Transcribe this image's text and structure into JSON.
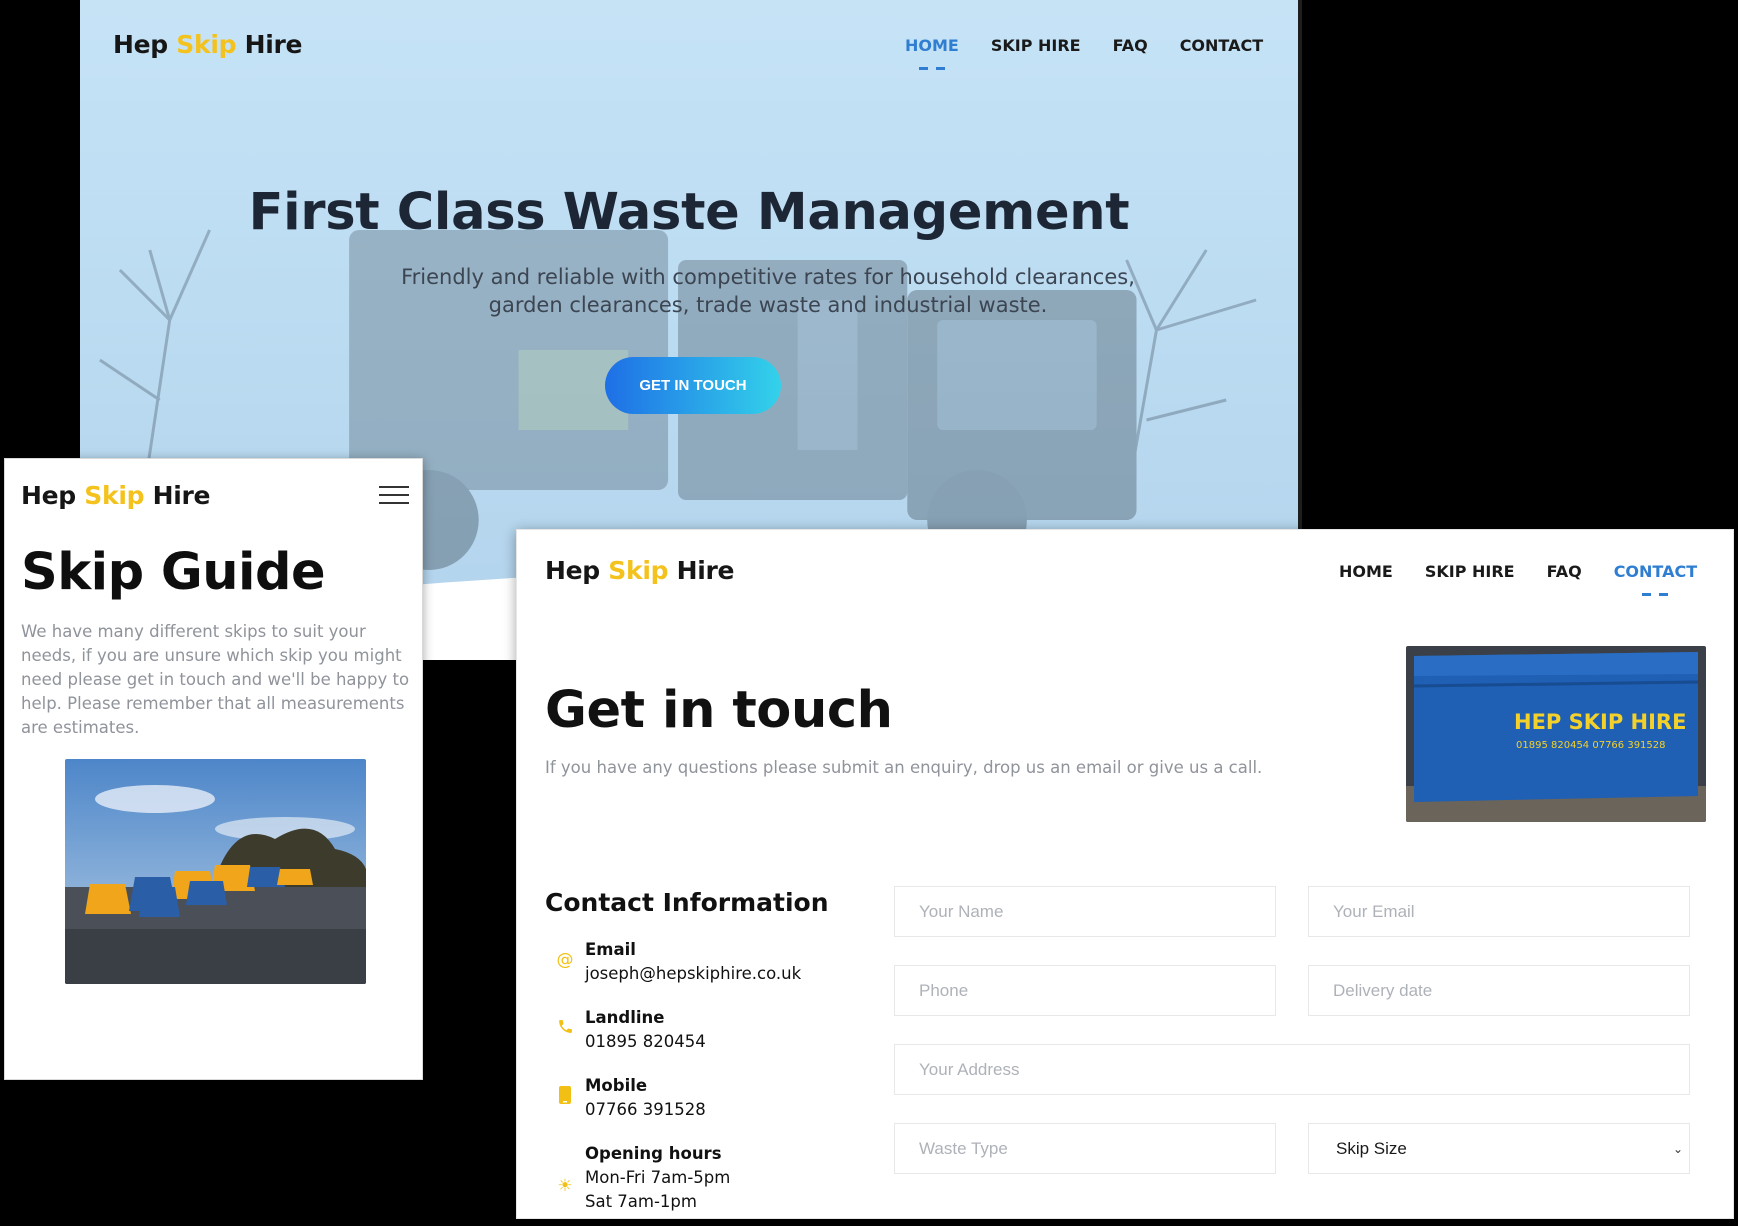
{
  "brand": {
    "part1": "Hep",
    "part2": "Skip",
    "part3": "Hire"
  },
  "hero": {
    "nav": [
      "HOME",
      "SKIP HIRE",
      "FAQ",
      "CONTACT"
    ],
    "active_nav": "HOME",
    "title": "First Class Waste Management",
    "subtitle": "Friendly and reliable with competitive rates for household clearances, garden clearances, trade waste and industrial waste.",
    "cta": "GET IN TOUCH"
  },
  "skip_guide": {
    "title": "Skip Guide",
    "text": "We have many different skips to suit your needs, if you are unsure which skip you might need please get in touch and we'll be happy to help. Please remember that all measurements are estimates."
  },
  "contact_page": {
    "nav": [
      "HOME",
      "SKIP HIRE",
      "FAQ",
      "CONTACT"
    ],
    "active_nav": "CONTACT",
    "title": "Get in touch",
    "subtitle": "If you have any questions please submit an enquiry, drop us an email or give us a call.",
    "info_title": "Contact Information",
    "items": [
      {
        "label": "Email",
        "lines": [
          "joseph@hepskiphire.co.uk"
        ],
        "icon": "at-icon"
      },
      {
        "label": "Landline",
        "lines": [
          "01895 820454"
        ],
        "icon": "phone-icon"
      },
      {
        "label": "Mobile",
        "lines": [
          "07766 391528"
        ],
        "icon": "mobile-icon"
      },
      {
        "label": "Opening hours",
        "lines": [
          "Mon-Fri 7am-5pm",
          "Sat 7am-1pm"
        ],
        "icon": "sun-icon"
      }
    ],
    "form": {
      "name_placeholder": "Your Name",
      "email_placeholder": "Your Email",
      "phone_placeholder": "Phone",
      "delivery_placeholder": "Delivery date",
      "address_placeholder": "Your Address",
      "waste_placeholder": "Waste Type",
      "skip_size_selected": "Skip Size"
    },
    "photo_skip_text": "HEP SKIP HIRE",
    "photo_skip_phones": "01895 820454  07766 391528"
  },
  "colors": {
    "accent_yellow": "#f4c21d",
    "accent_blue": "#2f7ed1",
    "button_start": "#1e6fe6",
    "button_end": "#33d2ea"
  }
}
